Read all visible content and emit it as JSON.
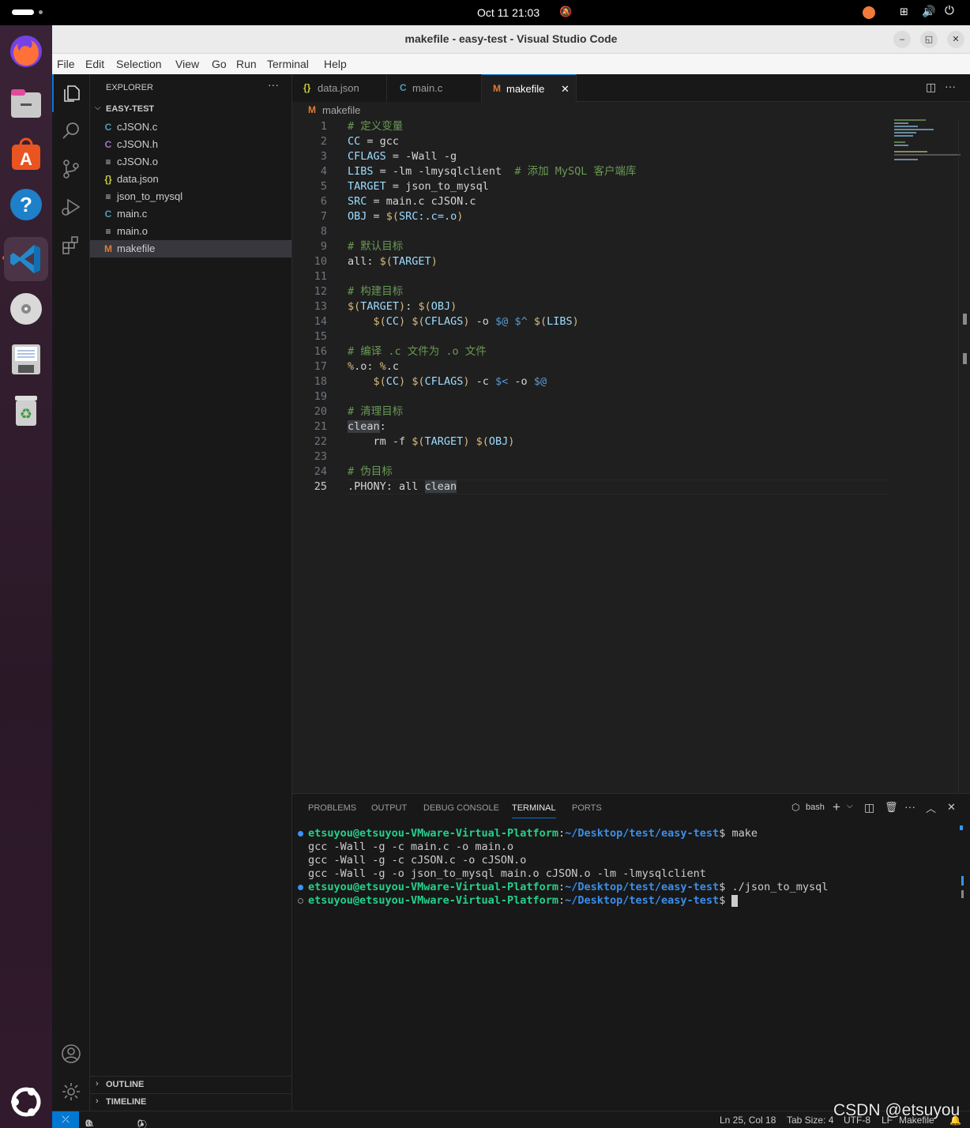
{
  "topbar": {
    "datetime": "Oct 11  21:03"
  },
  "window": {
    "title": "makefile - easy-test - Visual Studio Code"
  },
  "menu": [
    "File",
    "Edit",
    "Selection",
    "View",
    "Go",
    "Run",
    "Terminal",
    "Help"
  ],
  "explorer": {
    "header": "EXPLORER",
    "folder": "EASY-TEST",
    "files": [
      {
        "name": "cJSON.c",
        "icon": "C",
        "color": "#519aba"
      },
      {
        "name": "cJSON.h",
        "icon": "C",
        "color": "#a074c4"
      },
      {
        "name": "cJSON.o",
        "icon": "≡",
        "color": "#cccccc"
      },
      {
        "name": "data.json",
        "icon": "{}",
        "color": "#cbcb41"
      },
      {
        "name": "json_to_mysql",
        "icon": "≡",
        "color": "#cccccc"
      },
      {
        "name": "main.c",
        "icon": "C",
        "color": "#519aba"
      },
      {
        "name": "main.o",
        "icon": "≡",
        "color": "#cccccc"
      },
      {
        "name": "makefile",
        "icon": "M",
        "color": "#e37933"
      }
    ],
    "outline": "OUTLINE",
    "timeline": "TIMELINE"
  },
  "tabs": [
    {
      "icon": "{}",
      "label": "data.json",
      "color": "#cbcb41"
    },
    {
      "icon": "C",
      "label": "main.c",
      "color": "#519aba"
    },
    {
      "icon": "M",
      "label": "makefile",
      "color": "#e37933"
    }
  ],
  "breadcrumb": "makefile",
  "editor": {
    "line_numbers": [
      "1",
      "2",
      "3",
      "4",
      "5",
      "6",
      "7",
      "8",
      "9",
      "10",
      "11",
      "12",
      "13",
      "14",
      "15",
      "16",
      "17",
      "18",
      "19",
      "20",
      "21",
      "22",
      "23",
      "24",
      "25"
    ],
    "lines": [
      "# 定义变量",
      "CC = gcc",
      "CFLAGS = -Wall -g",
      "LIBS = -lm -lmysqlclient  # 添加 MySQL 客户端库",
      "TARGET = json_to_mysql",
      "SRC = main.c cJSON.c",
      "OBJ = $(SRC:.c=.o)",
      "",
      "# 默认目标",
      "all: $(TARGET)",
      "",
      "# 构建目标",
      "$(TARGET): $(OBJ)",
      "    $(CC) $(CFLAGS) -o $@ $^ $(LIBS)",
      "",
      "# 编译 .c 文件为 .o 文件",
      "%.o: %.c",
      "    $(CC) $(CFLAGS) -c $< -o $@",
      "",
      "# 清理目标",
      "clean:",
      "    rm -f $(TARGET) $(OBJ)",
      "",
      "# 伪目标",
      ".PHONY: all clean"
    ]
  },
  "panel": {
    "tabs": [
      "PROBLEMS",
      "OUTPUT",
      "DEBUG CONSOLE",
      "TERMINAL",
      "PORTS"
    ],
    "shell": "bash",
    "user": "etsuyou@etsuyou-VMware-Virtual-Platform",
    "path": "~/Desktop/test/easy-test",
    "cmd1": "make",
    "out1": "gcc -Wall -g -c main.c -o main.o",
    "out2": "gcc -Wall -g -c cJSON.c -o cJSON.o",
    "out3": "gcc -Wall -g -o json_to_mysql main.o cJSON.o -lm -lmysqlclient",
    "cmd2": "./json_to_mysql"
  },
  "status": {
    "errors": "0",
    "warnings": "0",
    "ports": "0",
    "position": "Ln 25, Col 18",
    "tabsize": "Tab Size: 4",
    "encoding": "UTF-8",
    "eol": "LF",
    "language": "Makefile"
  },
  "watermark": "CSDN @etsuyou"
}
